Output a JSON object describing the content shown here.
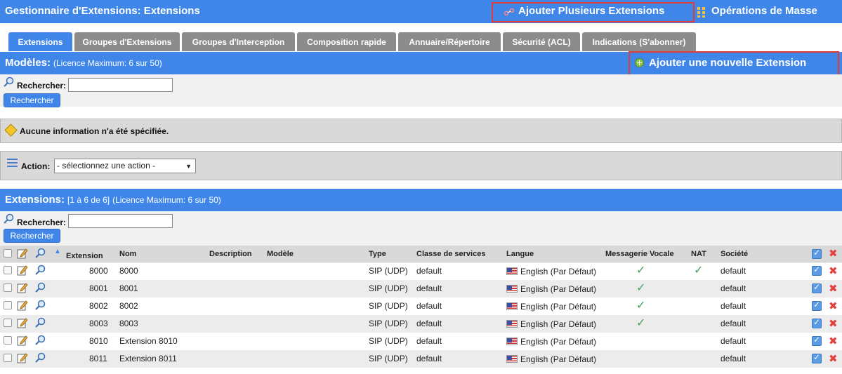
{
  "header": {
    "title": "Gestionnaire d'Extensions:  Extensions",
    "add_multiple_label": "Ajouter Plusieurs Extensions",
    "bulk_ops_label": "Opérations de Masse"
  },
  "tabs": [
    {
      "label": "Extensions",
      "active": true
    },
    {
      "label": "Groupes d'Extensions",
      "active": false
    },
    {
      "label": "Groupes d'Interception",
      "active": false
    },
    {
      "label": "Composition rapide",
      "active": false
    },
    {
      "label": "Annuaire/Répertoire",
      "active": false
    },
    {
      "label": "Sécurité (ACL)",
      "active": false
    },
    {
      "label": "Indications (S'abonner)",
      "active": false
    }
  ],
  "templates": {
    "title": "Modèles:",
    "subtitle": "(Licence Maximum: 6 sur 50)",
    "add_new_label": "Ajouter une nouvelle Extension",
    "search_label": "Rechercher:",
    "search_value": "",
    "search_button": "Rechercher"
  },
  "notice": {
    "text": "Aucune information n'a été spécifiée."
  },
  "action": {
    "label": "Action:",
    "selected": "- sélectionnez une action -"
  },
  "extensions": {
    "title": "Extensions:",
    "range": "[1 à 6 de 6]",
    "subtitle": "(Licence Maximum: 6 sur 50)",
    "search_label": "Rechercher:",
    "search_value": "",
    "search_button": "Rechercher",
    "columns": {
      "extension": "Extension",
      "nom": "Nom",
      "description": "Description",
      "modele": "Modèle",
      "type": "Type",
      "classe": "Classe de services",
      "langue": "Langue",
      "messagerie": "Messagerie Vocale",
      "nat": "NAT",
      "societe": "Société"
    },
    "rows": [
      {
        "extension": "8000",
        "nom": "8000",
        "type": "SIP (UDP)",
        "classe": "default",
        "langue": "English (Par Défaut)",
        "messagerie": true,
        "nat": true,
        "societe": "default"
      },
      {
        "extension": "8001",
        "nom": "8001",
        "type": "SIP (UDP)",
        "classe": "default",
        "langue": "English (Par Défaut)",
        "messagerie": true,
        "nat": false,
        "societe": "default"
      },
      {
        "extension": "8002",
        "nom": "8002",
        "type": "SIP (UDP)",
        "classe": "default",
        "langue": "English (Par Défaut)",
        "messagerie": true,
        "nat": false,
        "societe": "default"
      },
      {
        "extension": "8003",
        "nom": "8003",
        "type": "SIP (UDP)",
        "classe": "default",
        "langue": "English (Par Défaut)",
        "messagerie": true,
        "nat": false,
        "societe": "default"
      },
      {
        "extension": "8010",
        "nom": "Extension 8010",
        "type": "SIP (UDP)",
        "classe": "default",
        "langue": "English (Par Défaut)",
        "messagerie": false,
        "nat": false,
        "societe": "default"
      },
      {
        "extension": "8011",
        "nom": "Extension 8011",
        "type": "SIP (UDP)",
        "classe": "default",
        "langue": "English (Par Défaut)",
        "messagerie": false,
        "nat": false,
        "societe": "default"
      }
    ]
  },
  "colors": {
    "header_blue": "#3f86e8",
    "tab_inactive": "#8c8c8c",
    "highlight_red": "#e03b3b",
    "check_green": "#44a05a",
    "delete_red": "#e24040"
  }
}
